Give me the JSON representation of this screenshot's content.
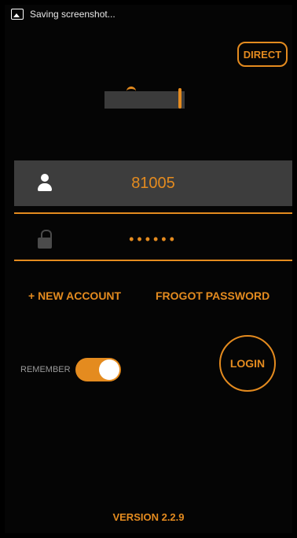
{
  "status_bar": {
    "icon": "image-icon",
    "text": "Saving screenshot..."
  },
  "header": {
    "direct_label": "DIRECT"
  },
  "login_form": {
    "username_value": "81005",
    "username_icon": "user-icon",
    "password_value": "••••••",
    "password_icon": "lock-icon"
  },
  "links": {
    "new_account": "+ NEW ACCOUNT",
    "forgot_password": "FROGOT PASSWORD"
  },
  "remember": {
    "label": "REMEMBER",
    "enabled": true
  },
  "login_button": {
    "label": "LOGIN"
  },
  "footer": {
    "version": "VERSION 2.2.9"
  },
  "colors": {
    "accent": "#e48b1f",
    "background": "#050505",
    "field_bg": "#3d3d3d"
  }
}
